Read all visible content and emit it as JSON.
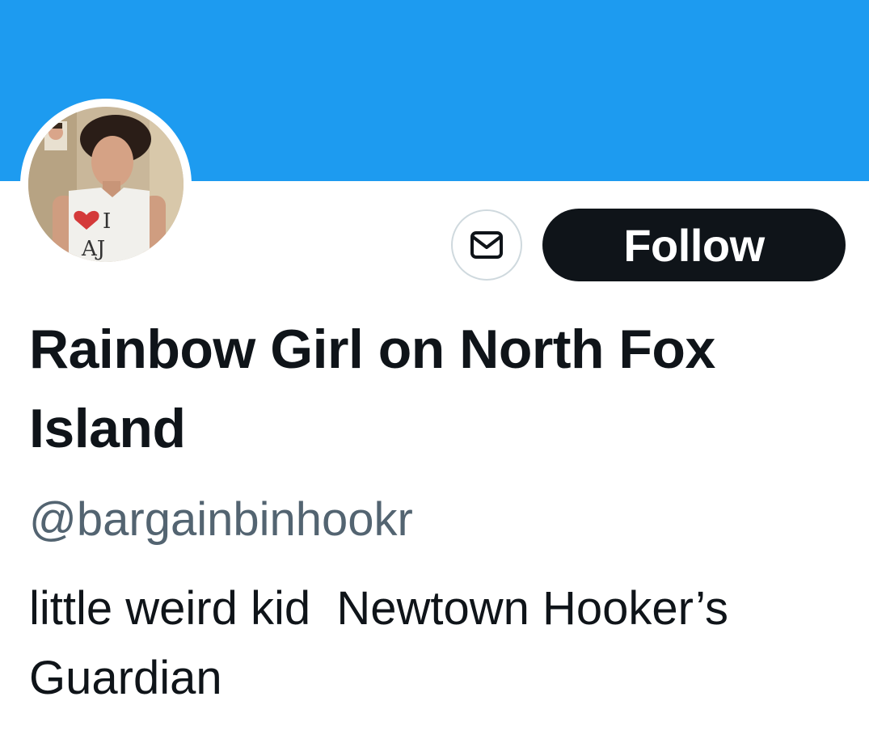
{
  "banner": {
    "color": "#1d9bf0"
  },
  "avatar": {
    "alt": "profile photo",
    "shirt_text": "I ❤ AJ"
  },
  "actions": {
    "message_icon": "envelope-icon",
    "follow_label": "Follow"
  },
  "profile": {
    "display_name": "Rainbow Girl on North Fox Island",
    "handle": "@bargainbinhookr",
    "bio": "little weird kid  Newtown Hooker’s Guardian"
  },
  "colors": {
    "text_primary": "#0f1419",
    "text_secondary": "#536471",
    "follow_bg": "#0f1419",
    "border": "#cfd9de"
  }
}
